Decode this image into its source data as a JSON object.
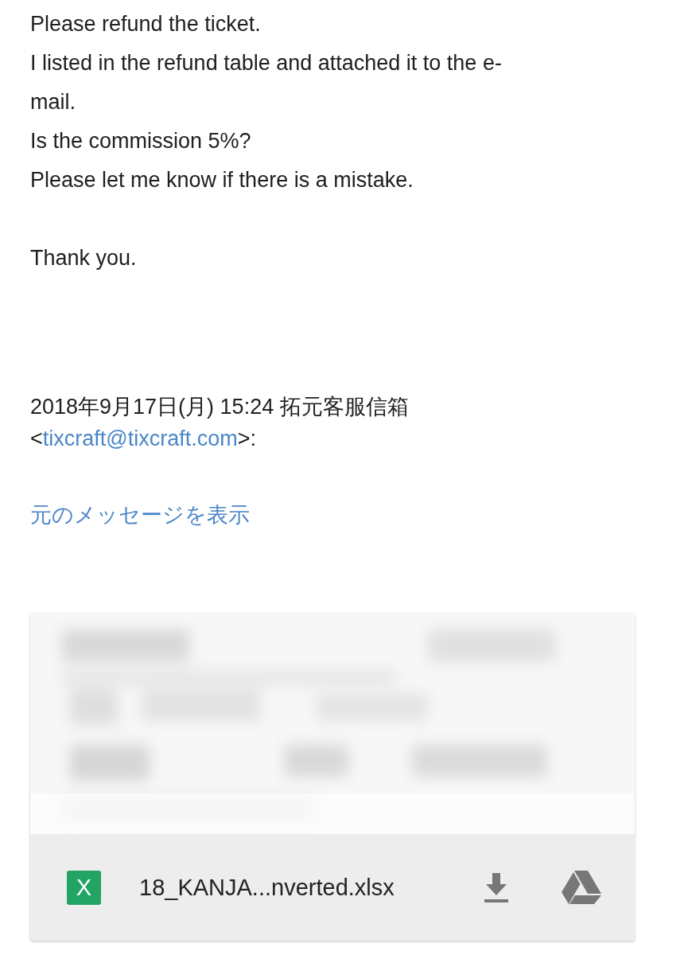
{
  "body": {
    "paragraphs": [
      [
        "Please refund the ticket.",
        "I listed in the refund table and attached it to the e-",
        "mail.",
        "Is the commission 5%?",
        "Please let me know if there is a mistake."
      ],
      [
        "Thank you."
      ]
    ]
  },
  "quote_header": {
    "date_sender": "2018年9月17日(月) 15:24 拓元客服信箱",
    "open": "<",
    "email": "tixcraft@tixcraft.com",
    "close": ">:"
  },
  "show_original_link": "元のメッセージを表示",
  "attachment": {
    "file_icon": "X",
    "file_name": "18_KANJA...nverted.xlsx"
  }
}
